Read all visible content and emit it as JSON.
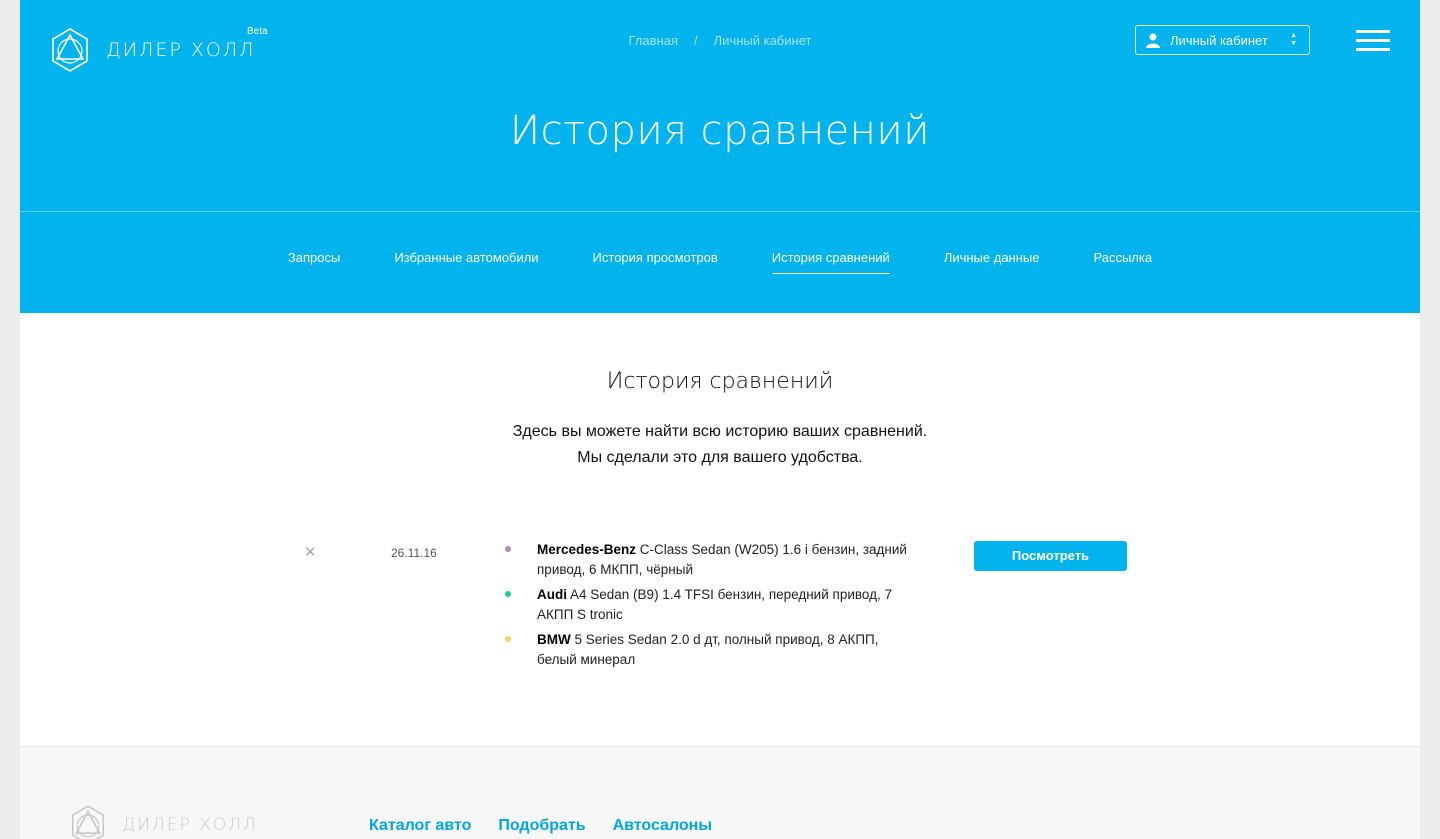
{
  "header": {
    "logo_text": "ДИЛЕР ХОЛЛ",
    "beta_label": "Beta",
    "breadcrumbs": [
      "Главная",
      "Личный кабинет"
    ],
    "breadcrumb_separator": "/",
    "account_select": {
      "label": "Личный кабинет",
      "icon": "user-icon"
    },
    "menu_icon": "hamburger-icon",
    "page_title": "История сравнений"
  },
  "tabs": [
    {
      "label": "Запросы",
      "active": false
    },
    {
      "label": "Избранные автомобили",
      "active": false
    },
    {
      "label": "История просмотров",
      "active": false
    },
    {
      "label": "История сравнений",
      "active": true
    },
    {
      "label": "Личные данные",
      "active": false
    },
    {
      "label": "Рассылка",
      "active": false
    }
  ],
  "main": {
    "title": "История сравнений",
    "intro_line1": "Здесь вы можете найти всю историю ваших сравнений.",
    "intro_line2": "Мы сделали это для вашего удобства."
  },
  "comparisons": [
    {
      "remove_icon": "close-icon",
      "remove_glyph": "✕",
      "date": "26.11.16",
      "button_label": "Посмотреть",
      "cars": [
        {
          "brand": "Mercedes-Benz",
          "description": " C-Class Sedan (W205) 1.6 i бензин, задний привод, 6 МКПП, чёрный",
          "dot_color": "#b58bb0"
        },
        {
          "brand": "Audi",
          "description": " A4 Sedan (B9) 1.4 TFSI бензин, передний привод, 7 АКПП S tronic",
          "dot_color": "#19d38e"
        },
        {
          "brand": "BMW",
          "description": " 5 Series Sedan 2.0 d дт, полный привод, 8 АКПП, белый минерал",
          "dot_color": "#f2d46b"
        }
      ]
    }
  ],
  "footer": {
    "logo_text": "ДИЛЕР ХОЛЛ",
    "links": [
      "Каталог авто",
      "Подобрать",
      "Автосалоны"
    ]
  },
  "colors": {
    "accent": "#02b3ee",
    "link": "#02a6e0"
  }
}
